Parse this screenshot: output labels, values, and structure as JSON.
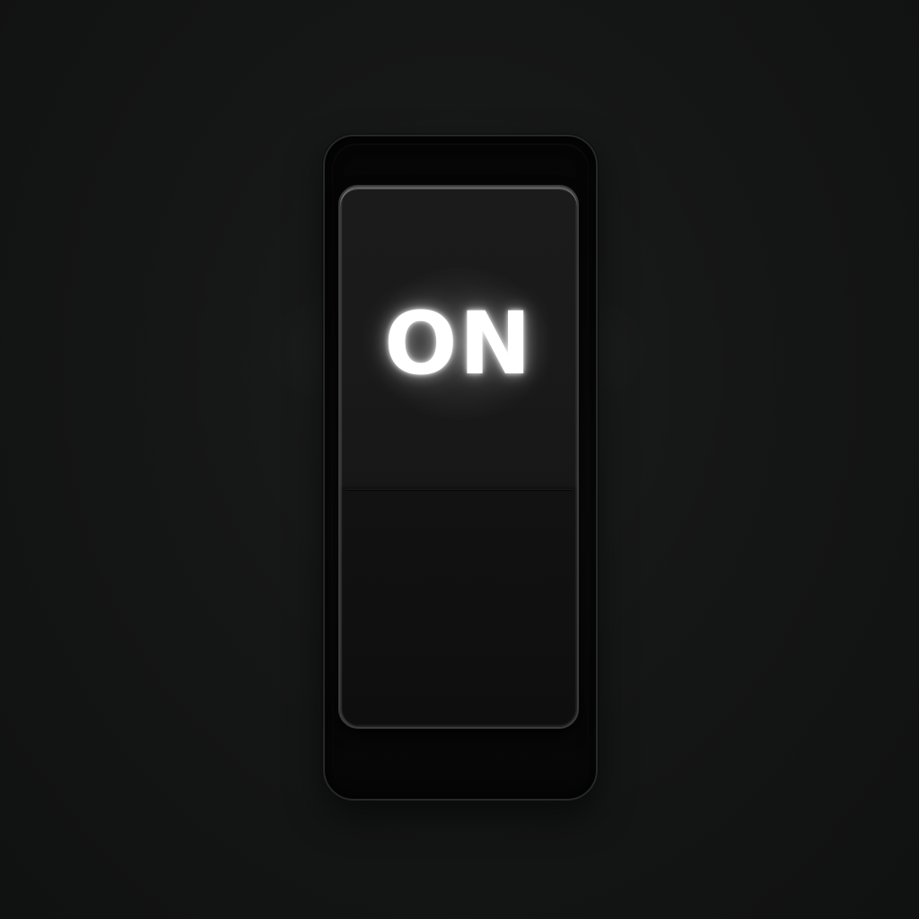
{
  "toggle_switch": {
    "state_label": "ON",
    "is_on": true
  },
  "colors": {
    "background": "#141515",
    "housing": "#070707",
    "rocker": "#181818",
    "label_glow": "#ffffff"
  }
}
